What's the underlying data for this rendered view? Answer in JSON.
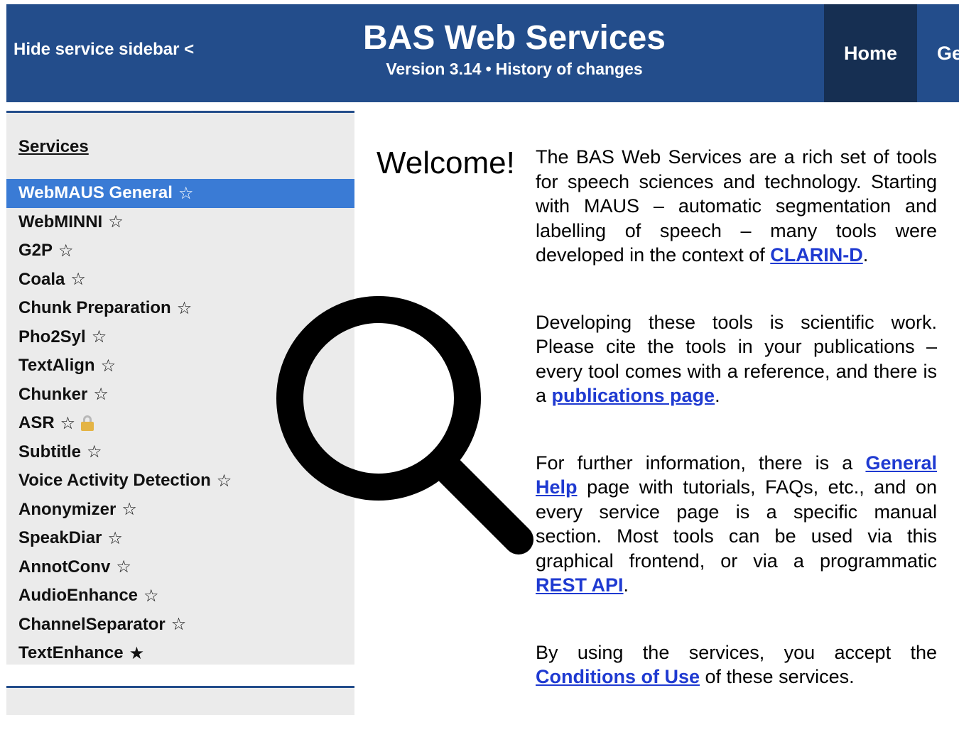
{
  "header": {
    "hide_sidebar": "Hide service sidebar <",
    "title": "BAS Web Services",
    "version": "Version 3.14",
    "separator": "•",
    "history_link": "History of changes",
    "nav": {
      "home": "Home",
      "next": "Ge"
    }
  },
  "sidebar": {
    "heading": "Services",
    "items": [
      {
        "label": "WebMAUS General",
        "star": "☆"
      },
      {
        "label": "WebMINNI",
        "star": "☆"
      },
      {
        "label": "G2P",
        "star": "☆"
      },
      {
        "label": "Coala",
        "star": "☆"
      },
      {
        "label": "Chunk Preparation",
        "star": "☆"
      },
      {
        "label": "Pho2Syl",
        "star": "☆"
      },
      {
        "label": "TextAlign",
        "star": "☆"
      },
      {
        "label": "Chunker",
        "star": "☆"
      },
      {
        "label": "ASR",
        "star": "☆"
      },
      {
        "label": "Subtitle",
        "star": "☆"
      },
      {
        "label": "Voice Activity Detection",
        "star": "☆"
      },
      {
        "label": "Anonymizer",
        "star": "☆"
      },
      {
        "label": "SpeakDiar",
        "star": "☆"
      },
      {
        "label": "AnnotConv",
        "star": "☆"
      },
      {
        "label": "AudioEnhance",
        "star": "☆"
      },
      {
        "label": "ChannelSeparator",
        "star": "☆"
      },
      {
        "label": "TextEnhance",
        "star": "★"
      }
    ]
  },
  "main": {
    "welcome": "Welcome!",
    "p1": {
      "text": "The BAS Web Services are a rich set of tools for speech sciences and technology. Starting with MAUS – automatic segmentation and labelling of speech – many tools were developed in the context of ",
      "link": "CLARIN-D",
      "after": "."
    },
    "p2": {
      "text": "Developing these tools is scientific work. Please cite the tools in your publications – every tool comes with a reference, and there is a ",
      "link": "publications page",
      "after": "."
    },
    "p3": {
      "text": "For further information, there is a ",
      "link1": "General Help",
      "mid": " page with tutorials, FAQs, etc., and on every service page is a specific manual section. Most tools can be used via this graphical frontend, or via a programmatic ",
      "link2": "REST API",
      "after": "."
    },
    "p4": {
      "text": "By using the services, you accept the ",
      "link": "Conditions of Use",
      "after": " of these services."
    }
  },
  "colors": {
    "header_bg": "#234d8b",
    "nav_active_bg": "#162f52",
    "active_item_bg": "#3a7bd5",
    "sidebar_bg": "#ebebeb",
    "link": "#1f3ad1"
  }
}
